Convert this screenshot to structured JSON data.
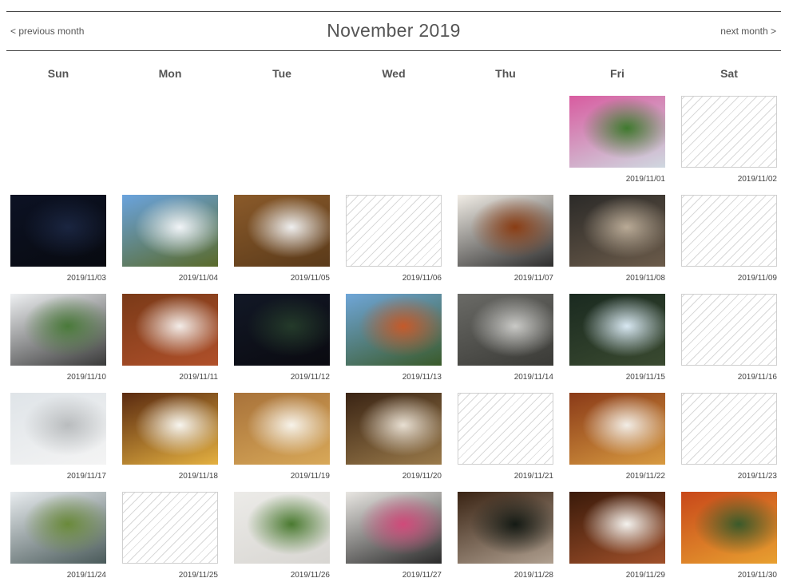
{
  "calendar": {
    "prev_label": "< previous month",
    "next_label": "next month >",
    "title": "November 2019",
    "weekdays": [
      "Sun",
      "Mon",
      "Tue",
      "Wed",
      "Thu",
      "Fri",
      "Sat"
    ],
    "empty_color": "#d9d9d9",
    "days": [
      {
        "date": "2019/11/01",
        "photo": true,
        "scene": "pink-flowers",
        "colors": [
          "#d85ca0",
          "#3f7a2e",
          "#cfd8e0"
        ]
      },
      {
        "date": "2019/11/02",
        "photo": false
      },
      {
        "date": "2019/11/03",
        "photo": true,
        "scene": "night-moon-river",
        "colors": [
          "#0c1224",
          "#1a2540",
          "#080a10"
        ]
      },
      {
        "date": "2019/11/04",
        "photo": true,
        "scene": "blue-sky-mountain",
        "colors": [
          "#6aa3dd",
          "#f1f4f7",
          "#5a6a2a"
        ]
      },
      {
        "date": "2019/11/05",
        "photo": true,
        "scene": "manju-sweet",
        "colors": [
          "#8a5a2a",
          "#efefef",
          "#5a3a1a"
        ]
      },
      {
        "date": "2019/11/06",
        "photo": false
      },
      {
        "date": "2019/11/07",
        "photo": true,
        "scene": "pasta-plate",
        "colors": [
          "#f1ede6",
          "#8a3d14",
          "#2d2d2d"
        ]
      },
      {
        "date": "2019/11/08",
        "photo": true,
        "scene": "bird-on-railing",
        "colors": [
          "#2b2a28",
          "#b9aa96",
          "#6b5b4a"
        ]
      },
      {
        "date": "2019/11/09",
        "photo": false
      },
      {
        "date": "2019/11/10",
        "photo": true,
        "scene": "horse-race-track",
        "colors": [
          "#eef0f2",
          "#4a7a3a",
          "#3a3a3a"
        ]
      },
      {
        "date": "2019/11/11",
        "photo": true,
        "scene": "maple-card",
        "colors": [
          "#7a3a18",
          "#f3ece8",
          "#b0502a"
        ]
      },
      {
        "date": "2019/11/12",
        "photo": true,
        "scene": "night-street",
        "colors": [
          "#121826",
          "#243a2a",
          "#0a0a10"
        ]
      },
      {
        "date": "2019/11/13",
        "photo": true,
        "scene": "autumn-park",
        "colors": [
          "#6fa6d8",
          "#c55a2a",
          "#3a5a2a"
        ]
      },
      {
        "date": "2019/11/14",
        "photo": true,
        "scene": "sidewalk",
        "colors": [
          "#6a6a66",
          "#c9c9c6",
          "#3a3a36"
        ]
      },
      {
        "date": "2019/11/15",
        "photo": true,
        "scene": "sun-through-trees",
        "colors": [
          "#1a2a20",
          "#d8e8f2",
          "#3a4a30"
        ]
      },
      {
        "date": "2019/11/16",
        "photo": false
      },
      {
        "date": "2019/11/17",
        "photo": true,
        "scene": "car-roof-ladybug",
        "colors": [
          "#dfe4e8",
          "#b9bcbe",
          "#f4f4f4"
        ]
      },
      {
        "date": "2019/11/18",
        "photo": true,
        "scene": "omurice",
        "colors": [
          "#5a2a10",
          "#f7f5ef",
          "#e4b040"
        ]
      },
      {
        "date": "2019/11/19",
        "photo": true,
        "scene": "carbonara",
        "colors": [
          "#a8723a",
          "#f7f3ea",
          "#d8a858"
        ]
      },
      {
        "date": "2019/11/20",
        "photo": true,
        "scene": "salad-plate",
        "colors": [
          "#3a2414",
          "#e8dfd2",
          "#9a7a4a"
        ]
      },
      {
        "date": "2019/11/21",
        "photo": false
      },
      {
        "date": "2019/11/22",
        "photo": true,
        "scene": "toast-breakfast",
        "colors": [
          "#8a3a18",
          "#f2ede6",
          "#d89a40"
        ]
      },
      {
        "date": "2019/11/23",
        "photo": false
      },
      {
        "date": "2019/11/24",
        "photo": true,
        "scene": "river-autumn",
        "colors": [
          "#e8ecef",
          "#6a8a3a",
          "#4a5a5a"
        ]
      },
      {
        "date": "2019/11/25",
        "photo": false
      },
      {
        "date": "2019/11/26",
        "photo": true,
        "scene": "green-mochi",
        "colors": [
          "#ecebe8",
          "#4a7a30",
          "#d8d6d2"
        ]
      },
      {
        "date": "2019/11/27",
        "photo": true,
        "scene": "onigiri-bottle",
        "colors": [
          "#e8e6e2",
          "#d04a7a",
          "#2a2a2a"
        ]
      },
      {
        "date": "2019/11/28",
        "photo": true,
        "scene": "window-night",
        "colors": [
          "#3a2414",
          "#141a14",
          "#b0a090"
        ]
      },
      {
        "date": "2019/11/29",
        "photo": true,
        "scene": "japanese-set-meal",
        "colors": [
          "#3a1a0a",
          "#f4f2ee",
          "#a0502a"
        ]
      },
      {
        "date": "2019/11/30",
        "photo": true,
        "scene": "red-maple-garden",
        "colors": [
          "#c8481a",
          "#3a5a2a",
          "#e8a030"
        ]
      }
    ]
  }
}
